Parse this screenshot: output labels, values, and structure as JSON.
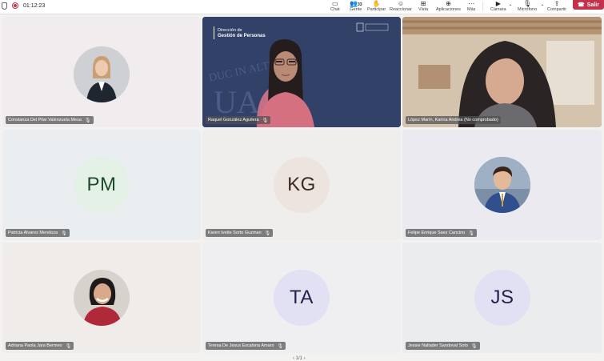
{
  "toolbar": {
    "timer": "01:12:23",
    "buttons": [
      {
        "label": "Chat",
        "icon": "chat-icon"
      },
      {
        "label": "Gente",
        "icon": "people-icon",
        "badge": "33"
      },
      {
        "label": "Participar",
        "icon": "raise-hand-icon"
      },
      {
        "label": "Reaccionar",
        "icon": "emoji-icon"
      },
      {
        "label": "Vista",
        "icon": "view-icon"
      },
      {
        "label": "Aplicaciones",
        "icon": "apps-icon"
      },
      {
        "label": "Más",
        "icon": "more-icon"
      },
      {
        "label": "Cámara",
        "icon": "camera-icon"
      },
      {
        "label": "Micrófono",
        "icon": "microphone-icon"
      },
      {
        "label": "Compartir",
        "icon": "share-icon"
      }
    ],
    "leave_label": "Salir",
    "leave_color": "#c4314b"
  },
  "participants": [
    {
      "name": "Constanza Del Pilar Valenzuela Mesa",
      "type": "photo"
    },
    {
      "name": "Raquel González Aguilera",
      "type": "video",
      "speaking": true
    },
    {
      "name": "López Marín, Karina Andrea (No comprobado)",
      "type": "video"
    },
    {
      "name": "Patricia Alvarez Mendoza",
      "type": "initials",
      "initials": "PM",
      "color": "#e3f1e6"
    },
    {
      "name": "Karen Ivette Sorto Guzman",
      "type": "initials",
      "initials": "KG",
      "color": "#eee4df"
    },
    {
      "name": "Felipe Enrique Saez Cancino",
      "type": "photo"
    },
    {
      "name": "Adriana Paola Jara Bermeo",
      "type": "photo"
    },
    {
      "name": "Teresa De Jesus Escalona Amaro",
      "type": "initials",
      "initials": "TA",
      "color": "#e2e1f4"
    },
    {
      "name": "Jessie Nallader Sandoval Soto",
      "type": "initials",
      "initials": "JS",
      "color": "#e2e1f4"
    }
  ],
  "slide": {
    "line1": "Dirección de",
    "line2": "Gestión de Personas",
    "watermark": "DUC IN ALTUM",
    "logo": "UA"
  },
  "pager": "‹ 1/1 ›"
}
